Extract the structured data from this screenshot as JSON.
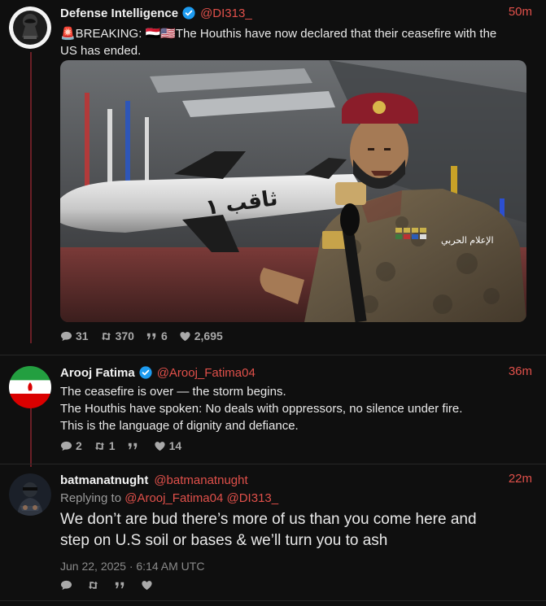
{
  "tweets": [
    {
      "name": "Defense Intelligence",
      "handle": "@DI313_",
      "time": "50m",
      "text_lines": [
        "🚨BREAKING: 🇾🇪🇺🇸The Houthis have now declared that their ceasefire with the",
        "US has ended."
      ],
      "media_caption": "الإعلام الحربي",
      "stats": {
        "comments": "31",
        "retweets": "370",
        "quotes": "6",
        "likes": "2,695"
      }
    },
    {
      "name": "Arooj Fatima",
      "handle": "@Arooj_Fatima04",
      "time": "36m",
      "text_lines": [
        "The ceasefire is over — the storm begins.",
        "The Houthis have spoken: No deals with oppressors, no silence under fire.",
        "This is the language of dignity and defiance."
      ],
      "stats": {
        "comments": "2",
        "retweets": "1",
        "quotes": "",
        "likes": "14"
      }
    },
    {
      "name": "batmanatnught",
      "handle": "@batmanatnught",
      "time": "22m",
      "reply_prefix": "Replying to",
      "reply_mentions": "@Arooj_Fatima04 @DI313_",
      "text_lines": [
        "We don’t are bud there’s more of us than you come here and",
        "step on U.S soil or bases & we’ll turn you to ash"
      ],
      "date": "Jun 22, 2025 · 6:14 AM UTC",
      "stats": {
        "comments": "",
        "retweets": "",
        "quotes": "",
        "likes": ""
      }
    }
  ],
  "colors": {
    "accent": "#e0504a",
    "verified": "#1d9bf0",
    "background": "#0f0f0f",
    "thread_rail": "#6a1f26"
  },
  "icons": [
    "comment-icon",
    "retweet-icon",
    "quote-icon",
    "heart-icon",
    "verified-badge-icon"
  ]
}
